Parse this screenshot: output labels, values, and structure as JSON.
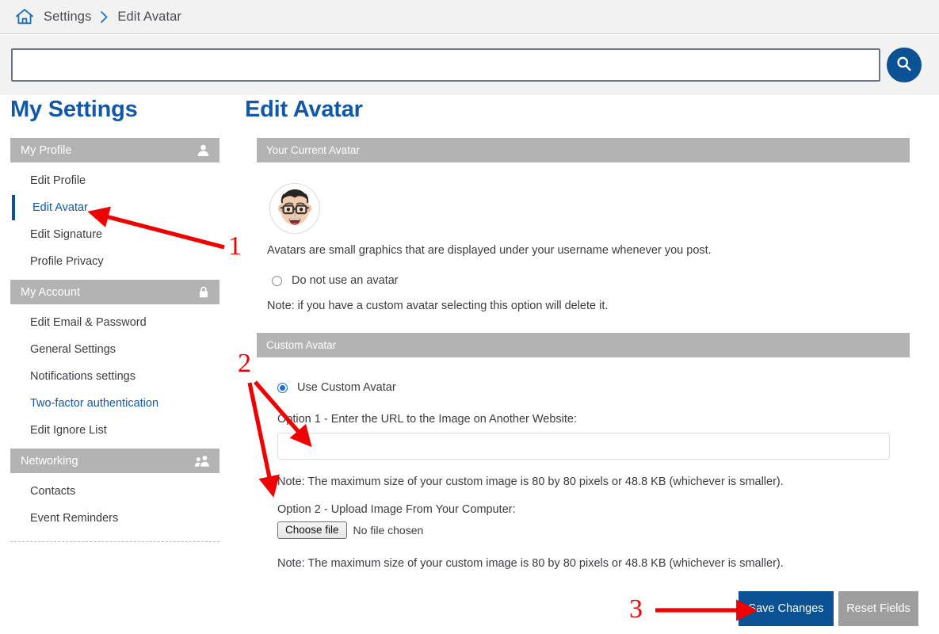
{
  "breadcrumb": {
    "home_icon": "home-icon",
    "items": [
      "Settings",
      "Edit Avatar"
    ],
    "separator": "›"
  },
  "search": {
    "value": "",
    "placeholder": "",
    "button_icon": "search-icon"
  },
  "headings": {
    "sidebar_title": "My Settings",
    "page_title": "Edit Avatar"
  },
  "sidebar": {
    "sections": [
      {
        "title": "My Profile",
        "icon": "user-icon",
        "items": [
          {
            "label": "Edit Profile",
            "state": "normal"
          },
          {
            "label": "Edit Avatar",
            "state": "active"
          },
          {
            "label": "Edit Signature",
            "state": "normal"
          },
          {
            "label": "Profile Privacy",
            "state": "normal"
          }
        ]
      },
      {
        "title": "My Account",
        "icon": "lock-icon",
        "items": [
          {
            "label": "Edit Email & Password",
            "state": "normal"
          },
          {
            "label": "General Settings",
            "state": "normal"
          },
          {
            "label": "Notifications settings",
            "state": "normal"
          },
          {
            "label": "Two-factor authentication",
            "state": "link"
          },
          {
            "label": "Edit Ignore List",
            "state": "normal"
          }
        ]
      },
      {
        "title": "Networking",
        "icon": "people-icon",
        "items": [
          {
            "label": "Contacts",
            "state": "normal"
          },
          {
            "label": "Event Reminders",
            "state": "normal"
          }
        ]
      }
    ]
  },
  "current_avatar_panel": {
    "header": "Your Current Avatar",
    "avatar_icon": "memoji-avatar",
    "description": "Avatars are small graphics that are displayed under your username whenever you post.",
    "no_avatar_option": {
      "label": "Do not use an avatar",
      "checked": false
    },
    "note": "Note: if you have a custom avatar selecting this option will delete it."
  },
  "custom_avatar_panel": {
    "header": "Custom Avatar",
    "use_custom_option": {
      "label": "Use Custom Avatar",
      "checked": true
    },
    "option1_label": "Option 1 - Enter the URL to the Image on Another Website:",
    "url_value": "",
    "url_placeholder": "",
    "note1": "Note: The maximum size of your custom image is 80 by 80 pixels or 48.8 KB (whichever is smaller).",
    "option2_label": "Option 2 - Upload Image From Your Computer:",
    "file_button_label": "Choose file",
    "file_status": "No file chosen",
    "note2": "Note: The maximum size of your custom image is 80 by 80 pixels or 48.8 KB (whichever is smaller)."
  },
  "footer": {
    "save_label": "Save Changes",
    "reset_label": "Reset Fields"
  },
  "annotations": {
    "marker1": "1",
    "marker2": "2",
    "marker3": "3",
    "color": "#f00000"
  },
  "colors": {
    "brand_blue": "#1258a8",
    "button_blue": "#0b5294",
    "section_gray": "#b3b3b3",
    "reset_gray": "#9e9e9e",
    "chrome_gray": "#f2f2f2",
    "text_dark": "#3b3b42"
  }
}
